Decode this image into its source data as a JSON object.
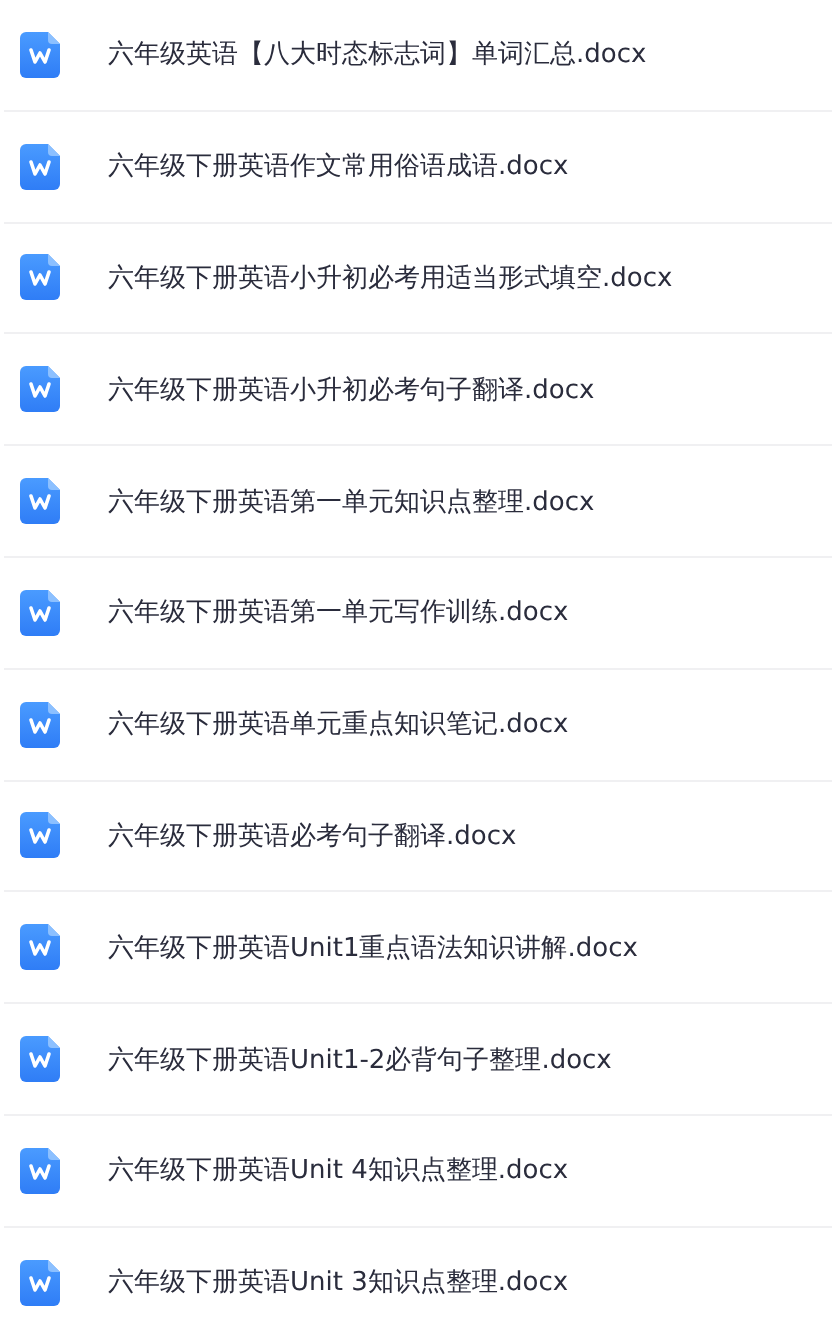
{
  "files": [
    {
      "name": "六年级英语【八大时态标志词】单词汇总.docx"
    },
    {
      "name": "六年级下册英语作文常用俗语成语.docx"
    },
    {
      "name": "六年级下册英语小升初必考用适当形式填空.docx"
    },
    {
      "name": "六年级下册英语小升初必考句子翻译.docx"
    },
    {
      "name": "六年级下册英语第一单元知识点整理.docx"
    },
    {
      "name": "六年级下册英语第一单元写作训练.docx"
    },
    {
      "name": "六年级下册英语单元重点知识笔记.docx"
    },
    {
      "name": "六年级下册英语必考句子翻译.docx"
    },
    {
      "name": "六年级下册英语Unit1重点语法知识讲解.docx"
    },
    {
      "name": "六年级下册英语Unit1-2必背句子整理.docx"
    },
    {
      "name": "六年级下册英语Unit 4知识点整理.docx"
    },
    {
      "name": "六年级下册英语Unit 3知识点整理.docx"
    }
  ]
}
